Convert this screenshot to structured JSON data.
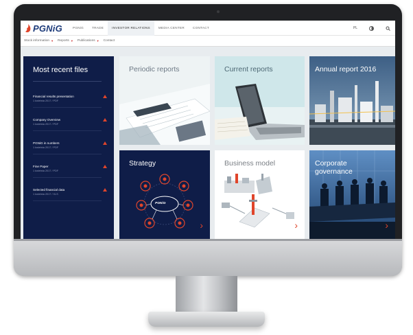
{
  "brand": {
    "name": "PGNiG",
    "accent": "#e0452b",
    "navy": "#0f1d48"
  },
  "topnav": {
    "items": [
      {
        "label": "PGNiG",
        "active": false
      },
      {
        "label": "TRADE",
        "active": false
      },
      {
        "label": "INVESTOR RELATIONS",
        "active": true
      },
      {
        "label": "MEDIA CENTER",
        "active": false
      },
      {
        "label": "CONTACT",
        "active": false
      }
    ],
    "tools": {
      "language": "PL",
      "accessibility_icon": "contrast-icon",
      "search_icon": "search-icon"
    }
  },
  "subnav": {
    "items": [
      "Stock information",
      "Reports",
      "Publications",
      "Contact"
    ]
  },
  "recent_files": {
    "title": "Most recent files",
    "files": [
      {
        "title": "Financial results presentation",
        "meta": "1 kwietnia 2017 / PDF"
      },
      {
        "title": "Company Overview",
        "meta": "1 kwietnia 2017 / PDF"
      },
      {
        "title": "PGNiG in numbers",
        "meta": "1 kwietnia 2017 / PDF"
      },
      {
        "title": "Fine Paper",
        "meta": "1 kwietnia 2017 / PDF"
      },
      {
        "title": "Selected financial data",
        "meta": "1 kwietnia 2017 / XLS"
      }
    ]
  },
  "tiles": {
    "periodic": {
      "title": "Periodic reports"
    },
    "current": {
      "title": "Current reports"
    },
    "annual": {
      "title": "Annual report 2016"
    },
    "strategy": {
      "title": "Strategy",
      "hub_label": "PGNiG"
    },
    "business": {
      "title": "Business model"
    },
    "corporate": {
      "title": "Corporate governance"
    }
  }
}
